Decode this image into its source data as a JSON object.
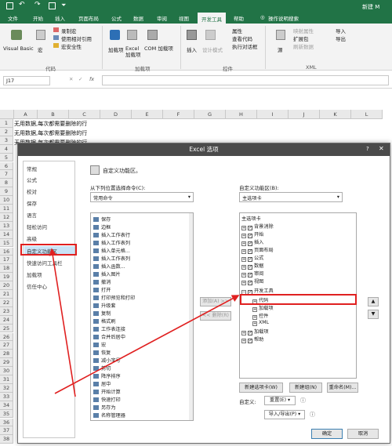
{
  "titlebar": {
    "app_name": "新建 M"
  },
  "tabs": [
    "文件",
    "开始",
    "插入",
    "页面布局",
    "公式",
    "数据",
    "审阅",
    "视图",
    "开发工具",
    "帮助",
    "操作说明搜索"
  ],
  "ribbon": {
    "vb": "Visual Basic",
    "macro": "宏",
    "record": "录制宏",
    "relative": "使用相对引用",
    "security": "宏安全性",
    "group_code": "代码",
    "addins": "加载项",
    "excel_addins": "Excel 加载项",
    "com_addins": "COM 加载项",
    "group_addins": "加载项",
    "insert": "插入",
    "design": "设计模式",
    "properties": "属性",
    "view_code": "查看代码",
    "run_dialog": "执行对话框",
    "group_controls": "控件",
    "source": "源",
    "map_props": "映射属性",
    "expansion": "扩展包",
    "refresh": "刷新数据",
    "import": "导入",
    "export": "导出",
    "group_xml": "XML"
  },
  "formula": {
    "namebox": "J17",
    "fx": "fx"
  },
  "columns": [
    "A",
    "B",
    "C",
    "D",
    "E",
    "F",
    "G",
    "H",
    "I",
    "J",
    "K",
    "L"
  ],
  "rows": [
    "1",
    "2",
    "3",
    "4",
    "5",
    "6",
    "7",
    "8",
    "9",
    "10",
    "11",
    "12",
    "13",
    "14",
    "15",
    "16",
    "17",
    "18",
    "19",
    "20",
    "21",
    "22",
    "23",
    "24",
    "25",
    "26",
    "27",
    "28",
    "29",
    "30",
    "31",
    "32",
    "33",
    "34",
    "35",
    "36",
    "37",
    "38"
  ],
  "cell_text": [
    "无用数据,每次都需要删除的行",
    "无用数据,每次都需要删除的行",
    "无用数据,每次都需要删除的行"
  ],
  "dialog": {
    "title": "Excel 选项",
    "help": "?",
    "nav": [
      "常规",
      "公式",
      "校对",
      "保存",
      "语言",
      "轻松访问",
      "高级",
      "自定义功能区",
      "快速访问工具栏",
      "加载项",
      "信任中心"
    ],
    "header": "自定义功能区。",
    "left_label": "从下列位置选择命令(C):",
    "left_value": "常用命令",
    "right_label": "自定义功能区(B):",
    "right_value": "主选项卡",
    "commands": [
      "保存",
      "边框",
      "插入工作表行",
      "插入工作表列",
      "插入单元格...",
      "插入工作表列",
      "插入函数...",
      "插入图片",
      "撤消",
      "打开",
      "打印预览和打印",
      "升级套",
      "复制",
      "格式刷",
      "工作表连接",
      "合并后居中",
      "宏",
      "恢复",
      "减小字号",
      "剪切",
      "降序排序",
      "居中",
      "开始计算",
      "快速打印",
      "另存为",
      "名称管理器"
    ],
    "add_button": "添加(A) >>",
    "remove_button": "<< 删除(R)",
    "tree_header": "主选项卡",
    "tree": [
      "背景消除",
      "开始",
      "插入",
      "页面布局",
      "公式",
      "数据",
      "审阅",
      "视图",
      "开发工具",
      "代码",
      "加载项",
      "控件",
      "XML",
      "加载项",
      "帮助"
    ],
    "new_tab": "新建选项卡(W)",
    "new_group": "新建组(N)",
    "rename": "重命名(M)...",
    "customize_label": "自定义:",
    "reset": "重置(E)",
    "import_export": "导入/导出(P)",
    "ok": "确定",
    "cancel": "取消"
  },
  "colors": {
    "excel_green": "#217346",
    "annotation_red": "#e02020",
    "selected_blue": "#c9e3f7"
  }
}
